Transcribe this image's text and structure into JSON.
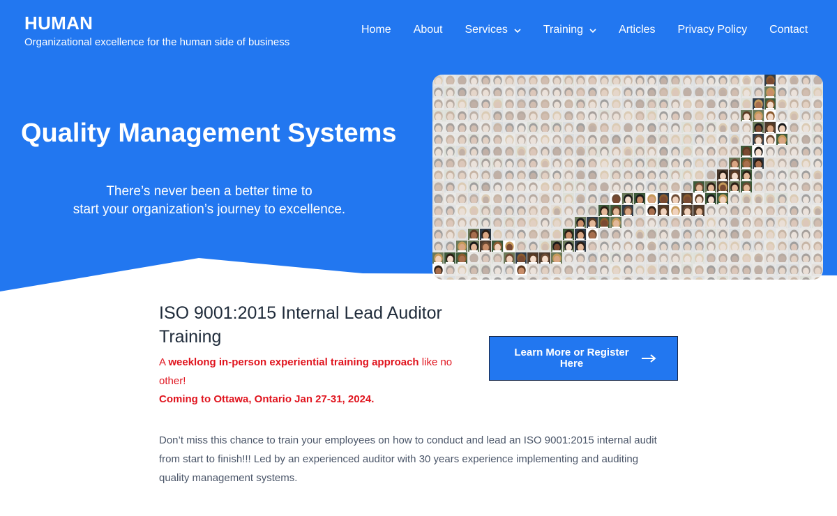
{
  "site": {
    "name": "HUMAN",
    "tagline": "Organizational excellence for the human side of business"
  },
  "nav": {
    "items": [
      {
        "label": "Home"
      },
      {
        "label": "About"
      },
      {
        "label": "Services"
      },
      {
        "label": "Training"
      },
      {
        "label": "Articles"
      },
      {
        "label": "Privacy Policy"
      },
      {
        "label": "Contact"
      }
    ]
  },
  "hero": {
    "title": "Quality Management Systems",
    "subtitle_line1": "There’s never been a better time to",
    "subtitle_line2": "start your organization’s journey to excellence."
  },
  "training": {
    "title": "ISO 9001:2015 Internal Lead Auditor Training",
    "intro_prefix": "A ",
    "intro_bold": "weeklong in-person experiential training approach",
    "intro_suffix": " like no other!",
    "coming": "Coming to Ottawa, Ontario Jan 27-31, 2024.",
    "cta_label": "Learn More or Register Here",
    "description": "Don’t miss this chance to train your employees on how to conduct and lead an ISO 9001:2015 internal audit from start to finish!!! Led by an experienced auditor with 30 years experience implementing and auditing quality management systems."
  },
  "colors": {
    "brand_blue": "#2277f0",
    "alert_red": "#e0141e",
    "heading_dark": "#1f2b3a"
  },
  "icons": {
    "dropdown": "chevron-down-icon",
    "cta": "arrow-right-icon"
  }
}
